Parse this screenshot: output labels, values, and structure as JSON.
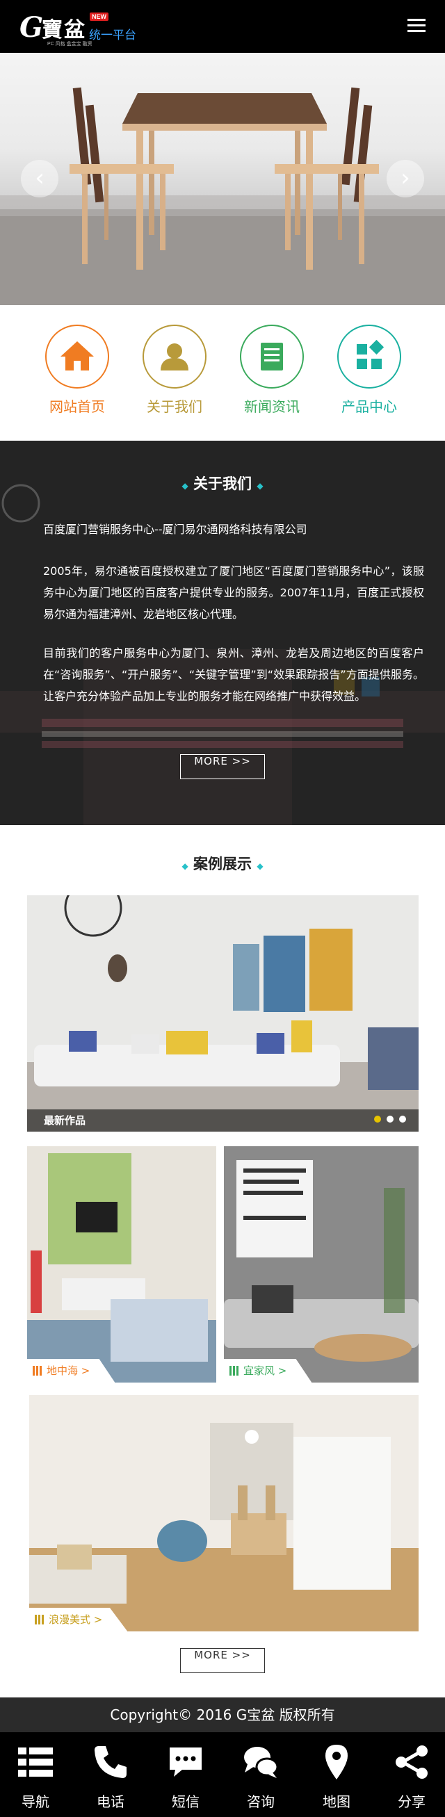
{
  "header": {
    "logo_g": "G",
    "logo_main": "寶盆",
    "logo_badge": "NEW",
    "logo_platform": "统一平台",
    "logo_sub": "PC 风格  盒金宝  融资"
  },
  "banner": {
    "prev_label": "‹",
    "next_label": "›"
  },
  "quick_nav": [
    {
      "label": "网站首页",
      "color": "#f07c22",
      "icon": "home-icon"
    },
    {
      "label": "关于我们",
      "color": "#b89a3a",
      "icon": "user-icon"
    },
    {
      "label": "新闻资讯",
      "color": "#3aaa5c",
      "icon": "news-icon"
    },
    {
      "label": "产品中心",
      "color": "#1ab0a0",
      "icon": "grid-icon"
    }
  ],
  "about": {
    "title": "关于我们",
    "paragraphs": [
      "百度厦门营销服务中心--厦门易尔通网络科技有限公司",
      "2005年，易尔通被百度授权建立了厦门地区“百度厦门营销服务中心”，该服务中心为厦门地区的百度客户提供专业的服务。2007年11月，百度正式授权易尔通为福建漳州、龙岩地区核心代理。",
      "目前我们的客户服务中心为厦门、泉州、漳州、龙岩及周边地区的百度客户在“咨询服务”、“开户服务”、“关键字管理”到“效果跟踪报告”方面提供服务。让客户充分体验产品加上专业的服务才能在网络推广中获得效益。"
    ],
    "more_label": "MORE >>"
  },
  "cases": {
    "title": "案例展示",
    "featured_caption": "最新作品",
    "items": [
      {
        "label": "地中海 >",
        "color": "#f07c22"
      },
      {
        "label": "宜家风 >",
        "color": "#3aaa5c"
      },
      {
        "label": "浪漫美式 >",
        "color": "#c8a020"
      }
    ],
    "more_label": "MORE >>"
  },
  "footer": {
    "copyright": "Copyright© 2016  G宝盆 版权所有"
  },
  "bottom_bar": [
    {
      "label": "导航",
      "icon": "list-icon"
    },
    {
      "label": "电话",
      "icon": "phone-icon"
    },
    {
      "label": "短信",
      "icon": "sms-icon"
    },
    {
      "label": "咨询",
      "icon": "chat-icon"
    },
    {
      "label": "地图",
      "icon": "map-pin-icon"
    },
    {
      "label": "分享",
      "icon": "share-icon"
    }
  ],
  "colors": {
    "accent_blue": "#3aa2ff",
    "diamond_teal": "#27c1c9"
  }
}
